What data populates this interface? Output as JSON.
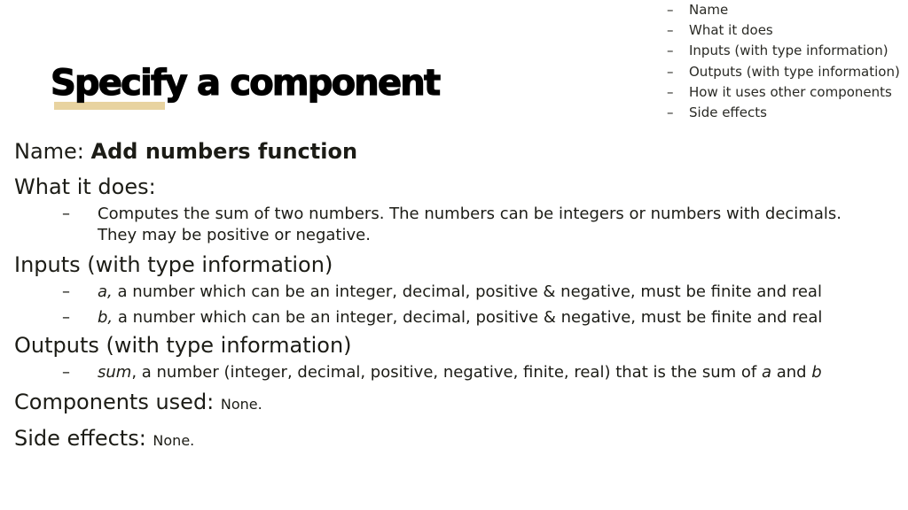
{
  "slide": {
    "title": "Specify a component",
    "accent_color": "#e8d3a0"
  },
  "checklist": {
    "bullet": "–",
    "items": [
      "Name",
      "What it does",
      "Inputs (with type information)",
      "Outputs (with type information)",
      "How it uses other components",
      "Side effects"
    ]
  },
  "spec": {
    "bullet": "–",
    "name": {
      "label": "Name: ",
      "value": "Add numbers function"
    },
    "what_it_does": {
      "label": "What it does:",
      "items": [
        {
          "line1": "Computes the sum of two numbers.  The numbers can be integers or numbers with decimals.",
          "line2": "They may be positive or negative."
        }
      ]
    },
    "inputs": {
      "label": "Inputs (with type information)",
      "items": [
        {
          "var": "a,",
          "text": " a number which can be an integer, decimal, positive & negative, must be finite and real"
        },
        {
          "var": "b,",
          "text": " a number which can be an integer, decimal, positive & negative, must be finite and real"
        }
      ]
    },
    "outputs": {
      "label": "Outputs (with type information)",
      "items": [
        {
          "var": "sum",
          "text": ", a number (integer, decimal, positive, negative, finite, real) that is the sum of ",
          "var_a": "a",
          "and": " and ",
          "var_b": "b"
        }
      ]
    },
    "components_used": {
      "label": "Components used: ",
      "value": "None."
    },
    "side_effects": {
      "label": "Side effects: ",
      "value": "None."
    }
  }
}
